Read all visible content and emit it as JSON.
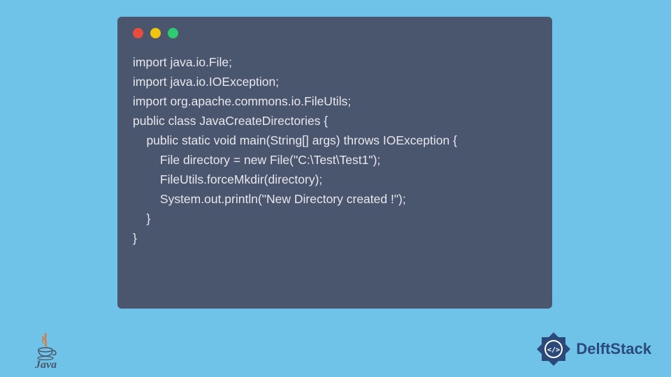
{
  "code": {
    "lines": [
      "import java.io.File;",
      "import java.io.IOException;",
      "import org.apache.commons.io.FileUtils;",
      "public class JavaCreateDirectories {",
      "",
      "    public static void main(String[] args) throws IOException {",
      "        File directory = new File(\"C:\\Test\\Test1\");",
      "        FileUtils.forceMkdir(directory);",
      "        System.out.println(\"New Directory created !\");",
      "    }",
      "",
      "}"
    ]
  },
  "logos": {
    "java_text": "Java",
    "delft_text": "DelftStack"
  },
  "colors": {
    "bg": "#6fc3e8",
    "window": "#4a556e",
    "code_text": "#e8e8ed",
    "dot_red": "#e74c3c",
    "dot_yellow": "#f1c40f",
    "dot_green": "#2ecc71",
    "delft_blue": "#2b4a7a"
  }
}
